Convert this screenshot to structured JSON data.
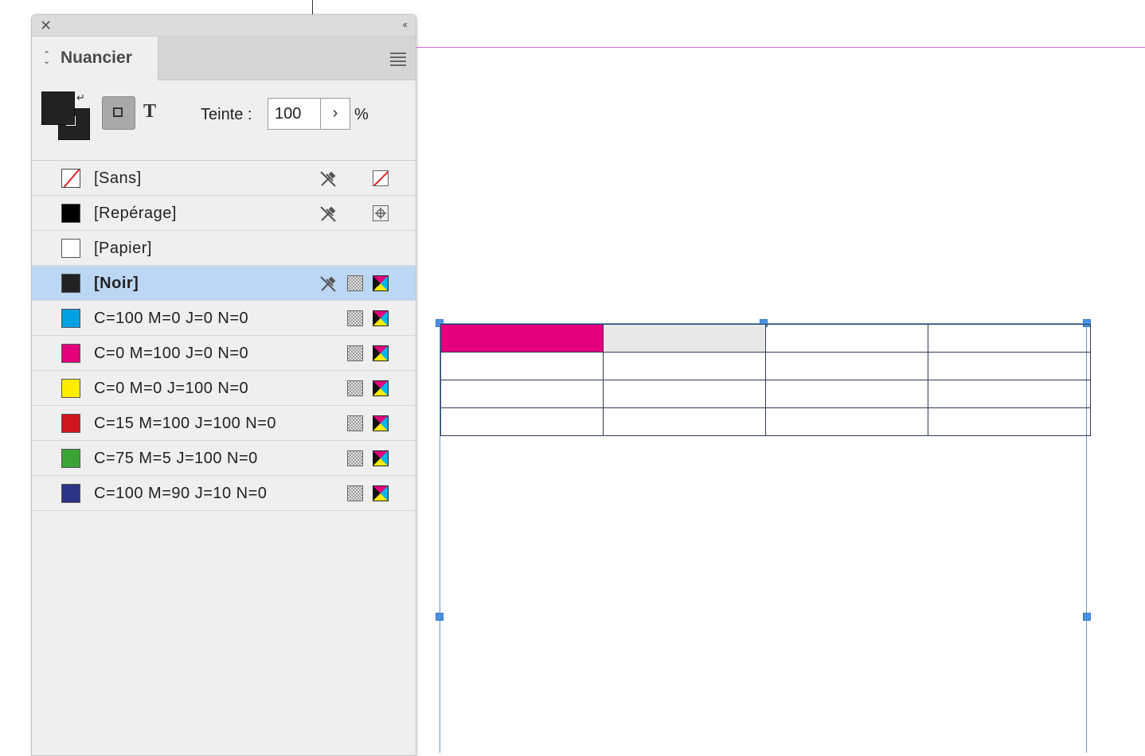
{
  "panel": {
    "title": "Nuancier",
    "close_icon": "close-icon",
    "collapse_icon": "collapse-icon",
    "menu_icon": "panel-menu-icon",
    "tint_label": "Teinte :",
    "tint_value": "100",
    "tint_unit": "%",
    "text_button_glyph": "T"
  },
  "swatches": [
    {
      "name": "[Sans]",
      "color": "none",
      "locked": true,
      "icons": [
        "no-edit-icon",
        "none-icon"
      ]
    },
    {
      "name": "[Repérage]",
      "color": "#000000",
      "locked": true,
      "icons": [
        "no-edit-icon",
        "registration-icon"
      ]
    },
    {
      "name": "[Papier]",
      "color": "#ffffff",
      "locked": false,
      "icons": []
    },
    {
      "name": "[Noir]",
      "color": "#222222",
      "locked": true,
      "selected": true,
      "icons": [
        "no-edit-icon",
        "process-icon",
        "cmyk-icon"
      ]
    },
    {
      "name": "C=100 M=0 J=0 N=0",
      "color": "#00a0e3",
      "icons": [
        "process-icon",
        "cmyk-icon"
      ]
    },
    {
      "name": "C=0 M=100 J=0 N=0",
      "color": "#e4007c",
      "icons": [
        "process-icon",
        "cmyk-icon"
      ]
    },
    {
      "name": "C=0 M=0 J=100 N=0",
      "color": "#ffed00",
      "icons": [
        "process-icon",
        "cmyk-icon"
      ]
    },
    {
      "name": "C=15 M=100 J=100 N=0",
      "color": "#d0161e",
      "icons": [
        "process-icon",
        "cmyk-icon"
      ]
    },
    {
      "name": "C=75 M=5 J=100 N=0",
      "color": "#3aa535",
      "icons": [
        "process-icon",
        "cmyk-icon"
      ]
    },
    {
      "name": "C=100 M=90 J=10 N=0",
      "color": "#2b3386",
      "icons": [
        "process-icon",
        "cmyk-icon"
      ]
    }
  ],
  "document": {
    "table_rows": 4,
    "table_cols": 4,
    "highlight_colors": {
      "magenta": "#e4007c",
      "grey": "#e8e8e8"
    },
    "margin_guide_color": "#d86ad8",
    "frame_color": "#5b9bd5"
  }
}
